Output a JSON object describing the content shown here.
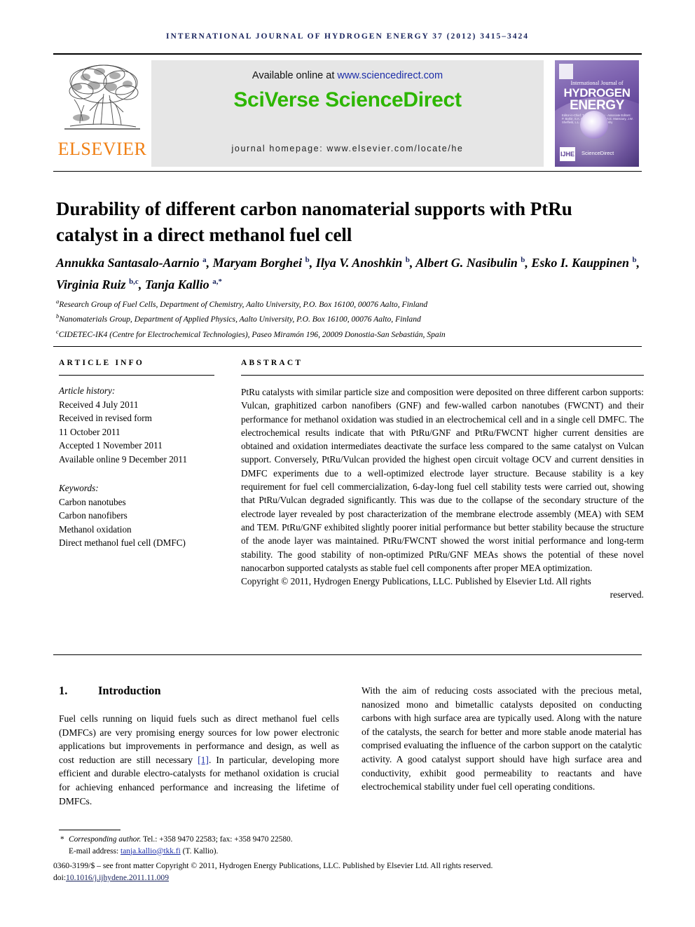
{
  "running_head": "INTERNATIONAL JOURNAL OF HYDROGEN ENERGY 37 (2012) 3415–3424",
  "masthead": {
    "publisher_name": "ELSEVIER",
    "available_prefix": "Available online at ",
    "available_url": "www.sciencedirect.com",
    "wordmark": "SciVerse ScienceDirect",
    "homepage": "journal homepage: www.elsevier.com/locate/he",
    "cover": {
      "line1": "International Journal of",
      "line2": "HYDROGEN",
      "line3": "ENERGY",
      "editors": "Editor-in-Chief: T. Nejat Veziroglu  ·  Associate Editors: P. Barbir, S.A. Sherif, M.A. Rosen, A.E. Mansoury, J.W. Sheffield, L.L. Grant and B.V. Yerbeshy",
      "badge": "IJHE",
      "sciencedirect": "ScienceDirect"
    }
  },
  "title": "Durability of different carbon nanomaterial supports with PtRu catalyst in a direct methanol fuel cell",
  "authors_html": "Annukka Santasalo-Aarnio <sup>a</sup>, Maryam Borghei <sup>b</sup>, Ilya V. Anoshkin <sup>b</sup>, Albert G. Nasibulin <sup>b</sup>, Esko I. Kauppinen <sup>b</sup>, Virginia Ruiz <sup>b,c</sup>, Tanja Kallio <sup>a,*</sup>",
  "affiliations": [
    {
      "mark": "a",
      "text": "Research Group of Fuel Cells, Department of Chemistry, Aalto University, P.O. Box 16100, 00076 Aalto, Finland"
    },
    {
      "mark": "b",
      "text": "Nanomaterials Group, Department of Applied Physics, Aalto University, P.O. Box 16100, 00076 Aalto, Finland"
    },
    {
      "mark": "c",
      "text": "CIDETEC-IK4 (Centre for Electrochemical Technologies), Paseo Miramón 196, 20009 Donostia-San Sebastián, Spain"
    }
  ],
  "article_info": {
    "heading": "Article info",
    "history_label": "Article history:",
    "history": [
      "Received 4 July 2011",
      "Received in revised form",
      "11 October 2011",
      "Accepted 1 November 2011",
      "Available online 9 December 2011"
    ],
    "keywords_label": "Keywords:",
    "keywords": [
      "Carbon nanotubes",
      "Carbon nanofibers",
      "Methanol oxidation",
      "Direct methanol fuel cell (DMFC)"
    ]
  },
  "abstract": {
    "heading": "Abstract",
    "body": "PtRu catalysts with similar particle size and composition were deposited on three different carbon supports: Vulcan, graphitized carbon nanofibers (GNF) and few-walled carbon nanotubes (FWCNT) and their performance for methanol oxidation was studied in an electrochemical cell and in a single cell DMFC. The electrochemical results indicate that with PtRu/GNF and PtRu/FWCNT higher current densities are obtained and oxidation intermediates deactivate the surface less compared to the same catalyst on Vulcan support. Conversely, PtRu/Vulcan provided the highest open circuit voltage OCV and current densities in DMFC experiments due to a well-optimized electrode layer structure. Because stability is a key requirement for fuel cell commercialization, 6-day-long fuel cell stability tests were carried out, showing that PtRu/Vulcan degraded significantly. This was due to the collapse of the secondary structure of the electrode layer revealed by post characterization of the membrane electrode assembly (MEA) with SEM and TEM. PtRu/GNF exhibited slightly poorer initial performance but better stability because the structure of the anode layer was maintained. PtRu/FWCNT showed the worst initial performance and long-term stability. The good stability of non-optimized PtRu/GNF MEAs shows the potential of these novel nanocarbon supported catalysts as stable fuel cell components after proper MEA optimization.",
    "copyright_main": "Copyright © 2011, Hydrogen Energy Publications, LLC. Published by Elsevier Ltd. All rights",
    "copyright_tail": "reserved."
  },
  "sections": {
    "intro_number": "1.",
    "intro_title": "Introduction",
    "intro_left_pre": "Fuel cells running on liquid fuels such as direct methanol fuel cells (DMFCs) are very promising energy sources for low power electronic applications but improvements in performance and design, as well as cost reduction are still necessary ",
    "intro_left_cite": "[1]",
    "intro_left_post": ". In particular, developing more efficient and durable electro-catalysts for methanol oxidation is crucial for achieving enhanced performance and increasing the lifetime of DMFCs.",
    "intro_right": "With the aim of reducing costs associated with the precious metal, nanosized mono and bimetallic catalysts deposited on conducting carbons with high surface area are typically used. Along with the nature of the catalysts, the search for better and more stable anode material has comprised evaluating the influence of the carbon support on the catalytic activity. A good catalyst support should have high surface area and conductivity, exhibit good permeability to reactants and have electrochemical stability under fuel cell operating conditions."
  },
  "footer": {
    "corresponding_star": "*",
    "corresponding_label": "Corresponding author.",
    "corresponding_contact": " Tel.: +358 9470 22583; fax: +358 9470 22580.",
    "email_label": "E-mail address: ",
    "email": "tanja.kallio@tkk.fi",
    "email_suffix": " (T. Kallio).",
    "issn_line": "0360-3199/$ – see front matter Copyright © 2011, Hydrogen Energy Publications, LLC. Published by Elsevier Ltd. All rights reserved.",
    "doi_prefix": "doi:",
    "doi_value": "10.1016/j.ijhydene.2011.11.009"
  },
  "colors": {
    "accent_blue": "#17225c",
    "link_blue": "#1c2da8",
    "sciencedirect_green": "#2db600",
    "elsevier_orange": "#f07f13"
  }
}
